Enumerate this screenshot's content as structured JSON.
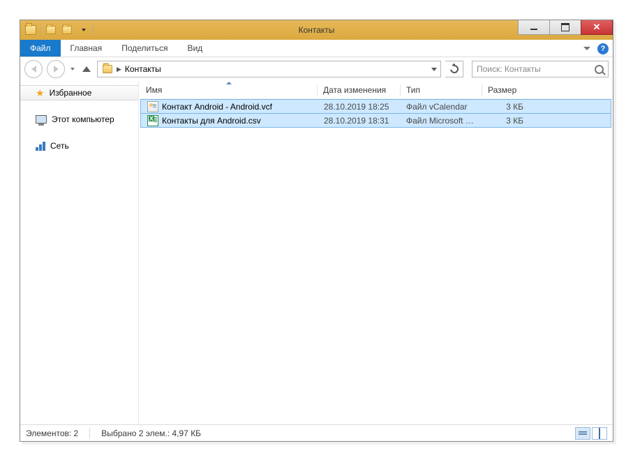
{
  "title": "Контакты",
  "ribbon": {
    "file": "Файл",
    "home": "Главная",
    "share": "Поделиться",
    "view": "Вид"
  },
  "breadcrumb": {
    "folder": "Контакты"
  },
  "search": {
    "placeholder": "Поиск: Контакты"
  },
  "columns": {
    "name": "Имя",
    "date": "Дата изменения",
    "type": "Тип",
    "size": "Размер"
  },
  "files": [
    {
      "name": "Контакт Android - Android.vcf",
      "date": "28.10.2019 18:25",
      "type": "Файл vCalendar",
      "size": "3 КБ"
    },
    {
      "name": "Контакты для Android.csv",
      "date": "28.10.2019 18:31",
      "type": "Файл Microsoft Ex...",
      "size": "3 КБ"
    }
  ],
  "navpane": {
    "favorites": "Избранное",
    "this_pc": "Этот компьютер",
    "network": "Сеть"
  },
  "status": {
    "items": "Элементов: 2",
    "selected": "Выбрано 2 элем.: 4,97 КБ"
  },
  "help": "?"
}
